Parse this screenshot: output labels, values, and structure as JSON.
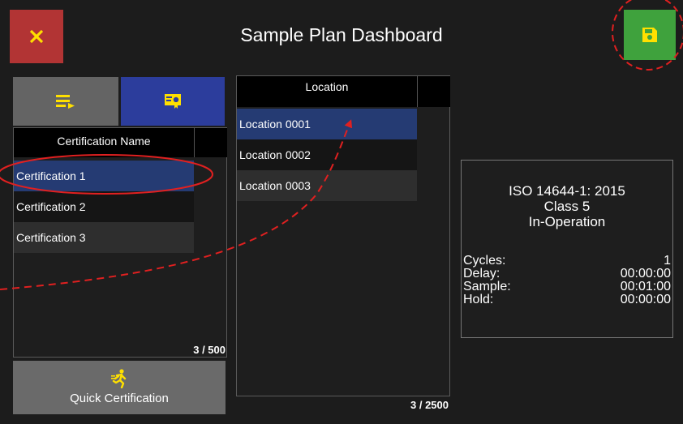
{
  "header": {
    "title": "Sample Plan Dashboard",
    "close_icon": "close-icon",
    "save_icon": "save-floppy-icon",
    "colors": {
      "close": "#b23434",
      "save": "#3fa23d"
    }
  },
  "certifications": {
    "view_buttons": [
      "list-view-icon",
      "certificate-view-icon"
    ],
    "column_header": "Certification Name",
    "items": [
      "Certification 1",
      "Certification 2",
      "Certification 3"
    ],
    "selected_index": 0,
    "count": "3 / 500"
  },
  "locations": {
    "column_header": "Location",
    "items": [
      "Location 0001",
      "Location 0002",
      "Location 0003"
    ],
    "selected_index": 0,
    "count": "3 / 2500"
  },
  "quick_certification": {
    "label": "Quick Certification",
    "icon": "running-person-icon"
  },
  "info": {
    "standard": "ISO 14644-1: 2015",
    "class": "Class 5",
    "state": "In-Operation",
    "rows": [
      {
        "label": "Cycles:",
        "value": "1"
      },
      {
        "label": "Delay:",
        "value": "00:00:00"
      },
      {
        "label": "Sample:",
        "value": "00:01:00"
      },
      {
        "label": "Hold:",
        "value": "00:00:00"
      }
    ]
  },
  "annotation_color": "#e02020"
}
